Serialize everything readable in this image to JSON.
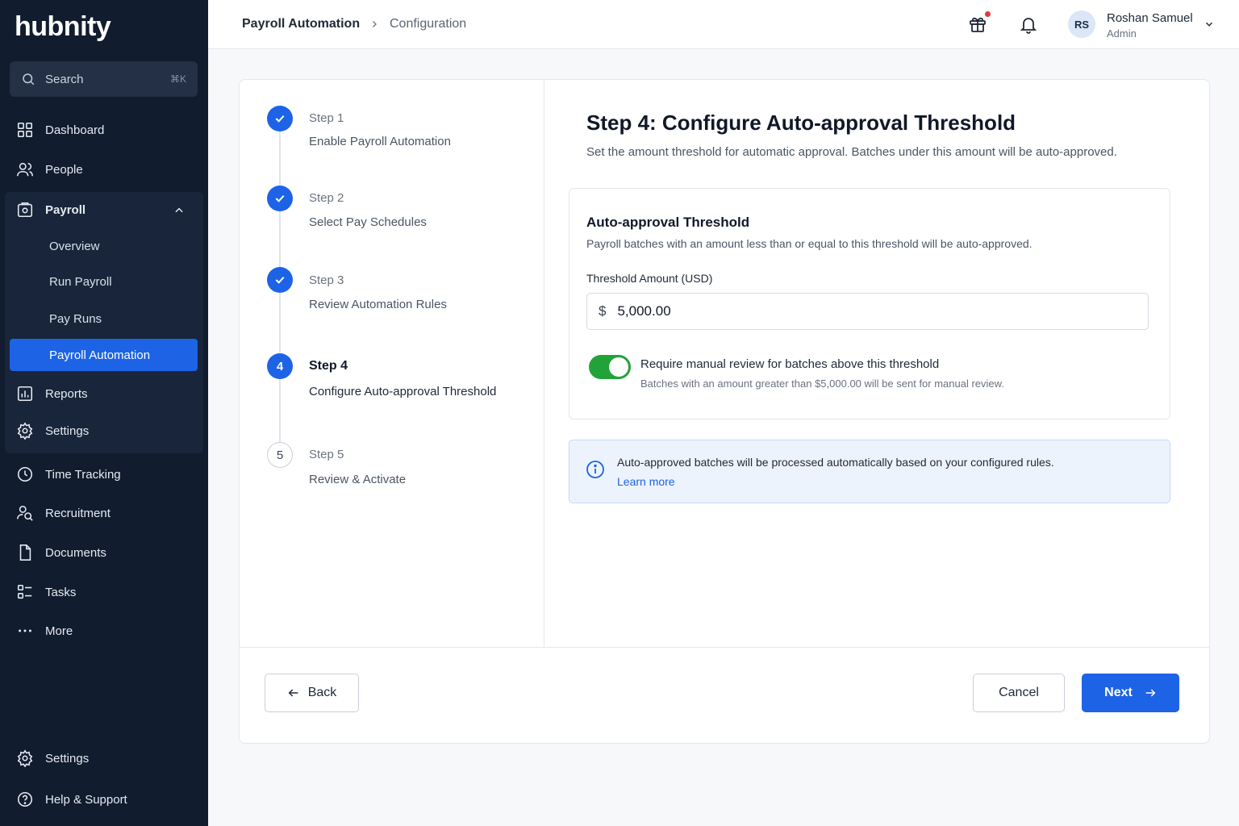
{
  "app": {
    "logo": "hubnity"
  },
  "search": {
    "label": "Search",
    "shortcut": "⌘K"
  },
  "sidebar": {
    "items": [
      {
        "label": "Dashboard",
        "icon": "grid-icon"
      },
      {
        "label": "People",
        "icon": "people-icon"
      },
      {
        "label": "Payroll",
        "icon": "payroll-icon"
      },
      {
        "label": "Reports",
        "icon": "reports-icon"
      },
      {
        "label": "Settings",
        "icon": "gear-icon"
      },
      {
        "label": "Time Tracking",
        "icon": "clock-icon"
      },
      {
        "label": "Recruitment",
        "icon": "recruitment-icon"
      },
      {
        "label": "Documents",
        "icon": "document-icon"
      },
      {
        "label": "Tasks",
        "icon": "tasks-icon"
      },
      {
        "label": "More",
        "icon": "more-icon"
      }
    ],
    "payroll_sub": [
      {
        "label": "Overview"
      },
      {
        "label": "Run Payroll"
      },
      {
        "label": "Pay Runs"
      },
      {
        "label": "Payroll Automation",
        "active": true
      }
    ],
    "bottom": [
      {
        "label": "Settings",
        "icon": "gear-icon"
      },
      {
        "label": "Help & Support",
        "icon": "help-icon"
      }
    ]
  },
  "header": {
    "breadcrumb": [
      "Payroll Automation",
      "Configuration"
    ],
    "user": {
      "initials": "RS",
      "name": "Roshan Samuel",
      "role": "Admin"
    }
  },
  "steps": [
    {
      "title": "Step 1",
      "desc": "Enable Payroll Automation",
      "state": "done"
    },
    {
      "title": "Step 2",
      "desc": "Select Pay Schedules",
      "state": "done"
    },
    {
      "title": "Step 3",
      "desc": "Review Automation Rules",
      "state": "done"
    },
    {
      "title": "Step 4",
      "desc": "Configure Auto-approval Threshold",
      "state": "current",
      "number": "4"
    },
    {
      "title": "Step 5",
      "desc": "Review & Activate",
      "state": "pending",
      "number": "5"
    }
  ],
  "main": {
    "title": "Step 4: Configure Auto-approval Threshold",
    "subtitle": "Set the amount threshold for automatic approval. Batches under this amount will be auto-approved.",
    "section": {
      "title": "Auto-approval Threshold",
      "description": "Payroll batches with an amount less than or equal to this threshold will be auto-approved.",
      "field_label": "Threshold Amount (USD)",
      "currency": "$",
      "amount": "5,000.00",
      "toggle_on": true,
      "toggle_label": "Require manual review for batches above this threshold",
      "toggle_help": "Batches with an amount greater than $5,000.00 will be sent for manual review."
    },
    "info": {
      "text": "Auto-approved batches will be processed automatically based on your configured rules.",
      "link": "Learn more"
    }
  },
  "footer": {
    "back": "Back",
    "cancel": "Cancel",
    "next": "Next"
  },
  "colors": {
    "primary": "#1d63e6",
    "sidebar_bg": "#111c2e",
    "toggle_on": "#22a33a",
    "notification_dot": "#e5383b"
  }
}
